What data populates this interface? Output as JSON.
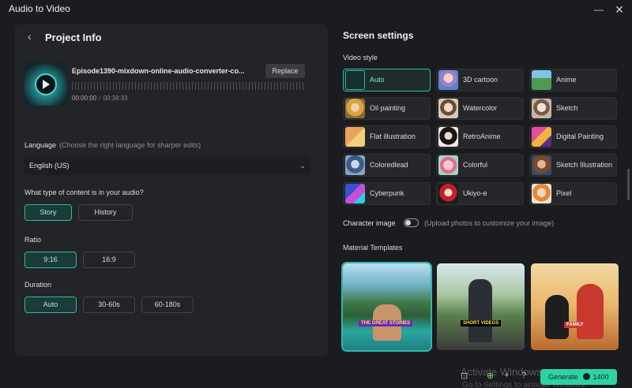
{
  "app": {
    "title": "Audio to Video"
  },
  "window": {
    "minimize": "—",
    "close": "✕"
  },
  "project": {
    "title": "Project Info",
    "file_name": "Episode1390-mixdown-online-audio-converter-co...",
    "replace_label": "Replace",
    "time_current": "00:00:00",
    "time_sep": "/",
    "time_total": "00:38:33"
  },
  "language": {
    "label": "Language",
    "hint": "(Choose the right language for sharper edits)",
    "value": "English (US)"
  },
  "content_type": {
    "question": "What type of content is in your audio?",
    "options": [
      "Story",
      "History"
    ],
    "selected": "Story"
  },
  "ratio": {
    "label": "Ratio",
    "options": [
      "9:16",
      "16:9"
    ],
    "selected": "9:16"
  },
  "duration": {
    "label": "Duration",
    "options": [
      "Auto",
      "30-60s",
      "60-180s"
    ],
    "selected": "Auto"
  },
  "screen": {
    "title": "Screen settings",
    "video_style_label": "Video style",
    "styles": [
      "Auto",
      "3D cartoon",
      "Anime",
      "Oil painting",
      "Watercolor",
      "Sketch",
      "Flat illustration",
      "RetroAnime",
      "Digital Painting",
      "Coloredlead",
      "Colorful",
      "Sketch Illustration",
      "Cyberpunk",
      "Ukiyo-e",
      "Pixel"
    ],
    "selected_style": "Auto",
    "character_label": "Character image",
    "character_hint": "(Upload photos to customize your image)",
    "character_enabled": false,
    "templates_label": "Material Templates",
    "templates": [
      {
        "caption": "THE GREAT STORIES"
      },
      {
        "caption": "SHORT VIDEOS"
      },
      {
        "caption": "FAMILY"
      }
    ]
  },
  "footer": {
    "watermark": "Activate Windows",
    "watermark_sub": "Go to Settings to activate Windows.",
    "generate_label": "Generate",
    "credits": "1400"
  },
  "colors": {
    "accent": "#2fb8a8",
    "generate": "#2fd3a3"
  }
}
